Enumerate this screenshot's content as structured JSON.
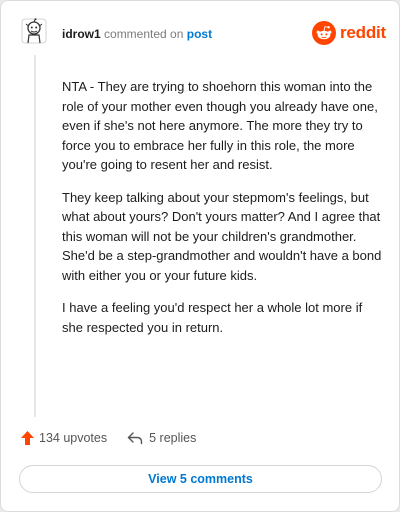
{
  "comment": {
    "username": "idrow1",
    "commented_text": "commented on",
    "post_link": "post",
    "paragraphs": [
      "NTA - They are trying to shoehorn this woman into the role of your mother even though you already have one, even if she's not here anymore. The more they try to force you to embrace her fully in this role, the more you're going to resent her and resist.",
      "They keep talking about your stepmom's feelings, but what about yours? Don't yours matter? And I agree that this woman will not be your children's grandmother. She'd be a step-grandmother and wouldn't have a bond with either you or your future kids.",
      "I have a feeling you'd respect her a whole lot more if she respected you in return."
    ]
  },
  "brand": {
    "wordmark": "reddit",
    "color": "#ff4500"
  },
  "actions": {
    "upvotes": "134 upvotes",
    "replies": "5 replies",
    "upvote_icon": "upvote-arrow-icon",
    "reply_icon": "reply-arrow-icon"
  },
  "view_comments_label": "View 5 comments",
  "colors": {
    "link": "#0079d3",
    "upvote": "#ff4500"
  }
}
